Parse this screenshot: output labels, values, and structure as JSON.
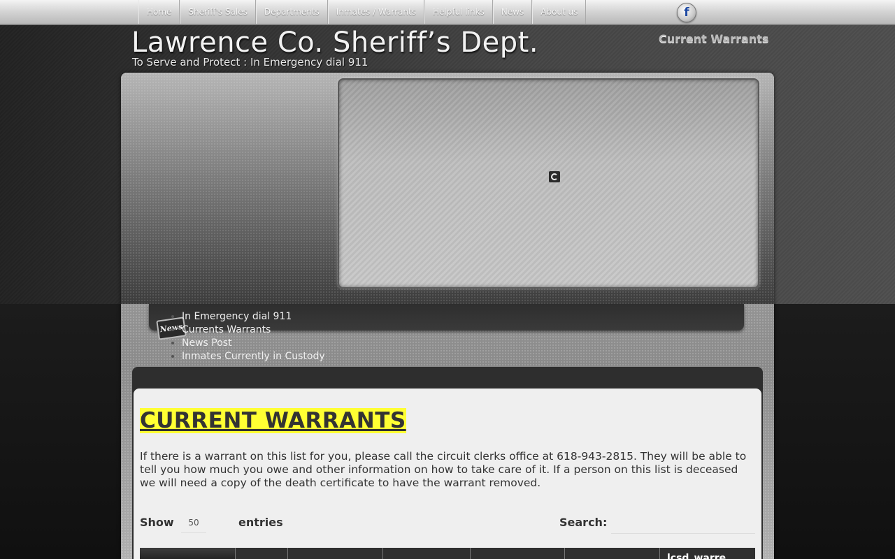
{
  "nav": {
    "items": [
      "Home",
      "Sheriff's Sales",
      "Departments",
      "Inmates / Warrants",
      "Helpful links",
      "News",
      "About us"
    ],
    "facebook_icon": "facebook-icon"
  },
  "header": {
    "title": "Lawrence Co. Sheriff’s Dept.",
    "tagline": "To Serve and Protect : In Emergency dial 911",
    "current_link": "Current Warrants"
  },
  "news": {
    "icon_label": "News",
    "items": [
      "In Emergency dial 911",
      "Currents Warrants",
      "News Post",
      "Inmates Currently in Custody"
    ]
  },
  "content": {
    "heading": "CURRENT WARRANTS",
    "intro": "If there is a warrant on this list for you, please call the circuit clerks office at 618-943-2815.  They will be able to tell you how much you owe and other information on how to take care of it. If a person on this list is deceased we will need a copy of the death certificate to have the warrant removed.",
    "show_label": "Show",
    "entries_value": "50",
    "entries_label": "entries",
    "search_label": "Search:",
    "search_value": "",
    "table_headers": [
      "",
      "",
      "",
      "",
      "",
      "",
      "lcsd_warre..."
    ]
  },
  "colors": {
    "heading_highlight": "#ffff33",
    "nav_bg": "#d6d6d6",
    "panel_dark": "#2e2e2e"
  }
}
